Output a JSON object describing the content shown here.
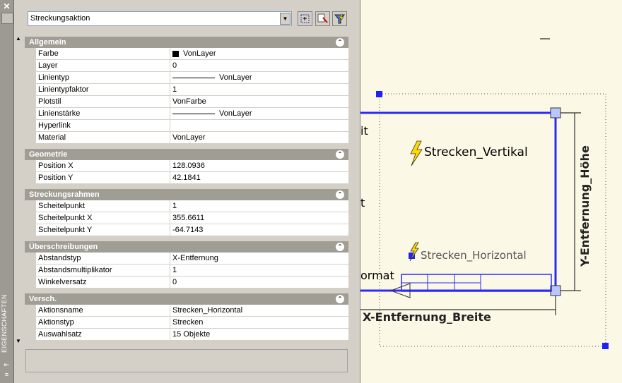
{
  "palette": {
    "side_label": "EIGENSCHAFTEN",
    "selection": "Streckungsaktion",
    "categories": [
      {
        "title": "Allgemein",
        "rows": [
          {
            "name": "Farbe",
            "value": "VonLayer",
            "kind": "color"
          },
          {
            "name": "Layer",
            "value": "0"
          },
          {
            "name": "Linientyp",
            "value": "VonLayer",
            "kind": "line"
          },
          {
            "name": "Linientypfaktor",
            "value": "1"
          },
          {
            "name": "Plotstil",
            "value": "VonFarbe"
          },
          {
            "name": "Linienstärke",
            "value": "VonLayer",
            "kind": "line"
          },
          {
            "name": "Hyperlink",
            "value": ""
          },
          {
            "name": "Material",
            "value": "VonLayer"
          }
        ]
      },
      {
        "title": "Geometrie",
        "rows": [
          {
            "name": "Position X",
            "value": "128.0936"
          },
          {
            "name": "Position Y",
            "value": "42.1841"
          }
        ]
      },
      {
        "title": "Streckungsrahmen",
        "rows": [
          {
            "name": "Scheitelpunkt",
            "value": "1"
          },
          {
            "name": "Scheitelpunkt X",
            "value": "355.6611"
          },
          {
            "name": "Scheitelpunkt Y",
            "value": "-64.7143"
          }
        ]
      },
      {
        "title": "Überschreibungen",
        "rows": [
          {
            "name": "Abstandstyp",
            "value": "X-Entfernung"
          },
          {
            "name": "Abstandsmultiplikator",
            "value": "1"
          },
          {
            "name": "Winkelversatz",
            "value": "0"
          }
        ]
      },
      {
        "title": "Versch.",
        "rows": [
          {
            "name": "Aktionsname",
            "value": "Strecken_Horizontal"
          },
          {
            "name": "Aktionstyp",
            "value": "Strecken"
          },
          {
            "name": "Auswahlsatz",
            "value": "15 Objekte"
          }
        ]
      }
    ]
  },
  "drawing": {
    "label_vertical": "Strecken_Vertikal",
    "label_horizontal": "Strecken_Horizontal",
    "label_x_dim": "X-Entfernung_Breite",
    "label_y_dim": "Y-Entfernung_Höhe",
    "partial_1": "it",
    "partial_2": "t",
    "partial_3": "ormat",
    "accent": "#0000ff",
    "lightning": "#ffd800"
  }
}
